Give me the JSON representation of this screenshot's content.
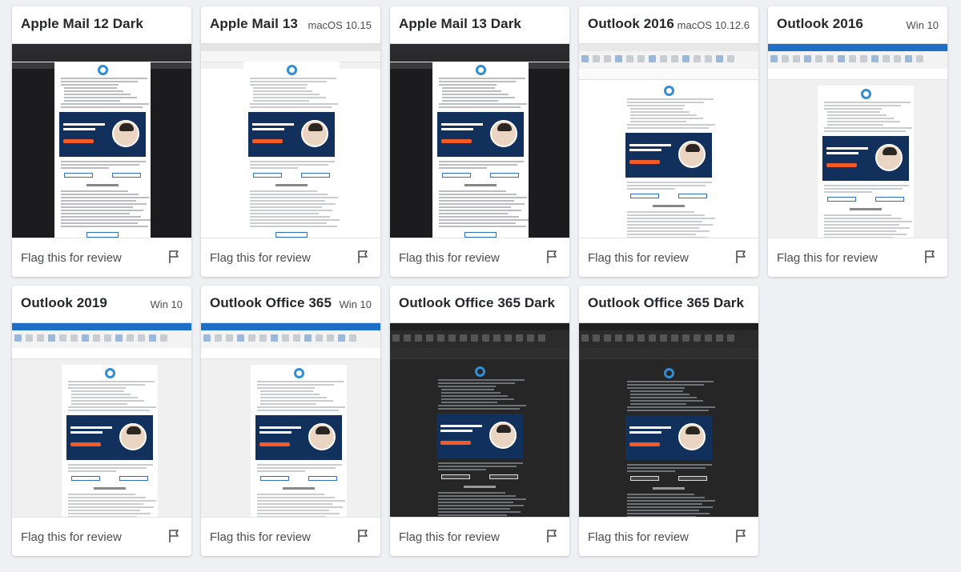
{
  "cards": [
    {
      "title": "Apple Mail 12 Dark",
      "os": "",
      "flag_label": "Flag this for review",
      "theme": "apple-dark"
    },
    {
      "title": "Apple Mail 13",
      "os": "macOS 10.15",
      "flag_label": "Flag this for review",
      "theme": "apple-light"
    },
    {
      "title": "Apple Mail 13 Dark",
      "os": "",
      "flag_label": "Flag this for review",
      "theme": "apple-dark"
    },
    {
      "title": "Outlook 2016",
      "os": "macOS 10.12.6",
      "flag_label": "Flag this for review",
      "theme": "outlook-mac"
    },
    {
      "title": "Outlook 2016",
      "os": "Win 10",
      "flag_label": "Flag this for review",
      "theme": "outlook-win"
    },
    {
      "title": "Outlook 2019",
      "os": "Win 10",
      "flag_label": "Flag this for review",
      "theme": "outlook-win"
    },
    {
      "title": "Outlook Office 365",
      "os": "Win 10",
      "flag_label": "Flag this for review",
      "theme": "outlook-win"
    },
    {
      "title": "Outlook Office 365 Dark",
      "os": "",
      "flag_label": "Flag this for review",
      "theme": "o365-dark"
    },
    {
      "title": "Outlook Office 365 Dark",
      "os": "",
      "flag_label": "Flag this for review",
      "theme": "o365-dark2"
    }
  ],
  "icons": {
    "flag": "flag-icon",
    "logo": "logo-icon"
  },
  "colors": {
    "accent": "#2f8ed6",
    "banner": "#12305c",
    "brand_orange": "#f25a27",
    "outlook_blue": "#1e6fc5"
  }
}
